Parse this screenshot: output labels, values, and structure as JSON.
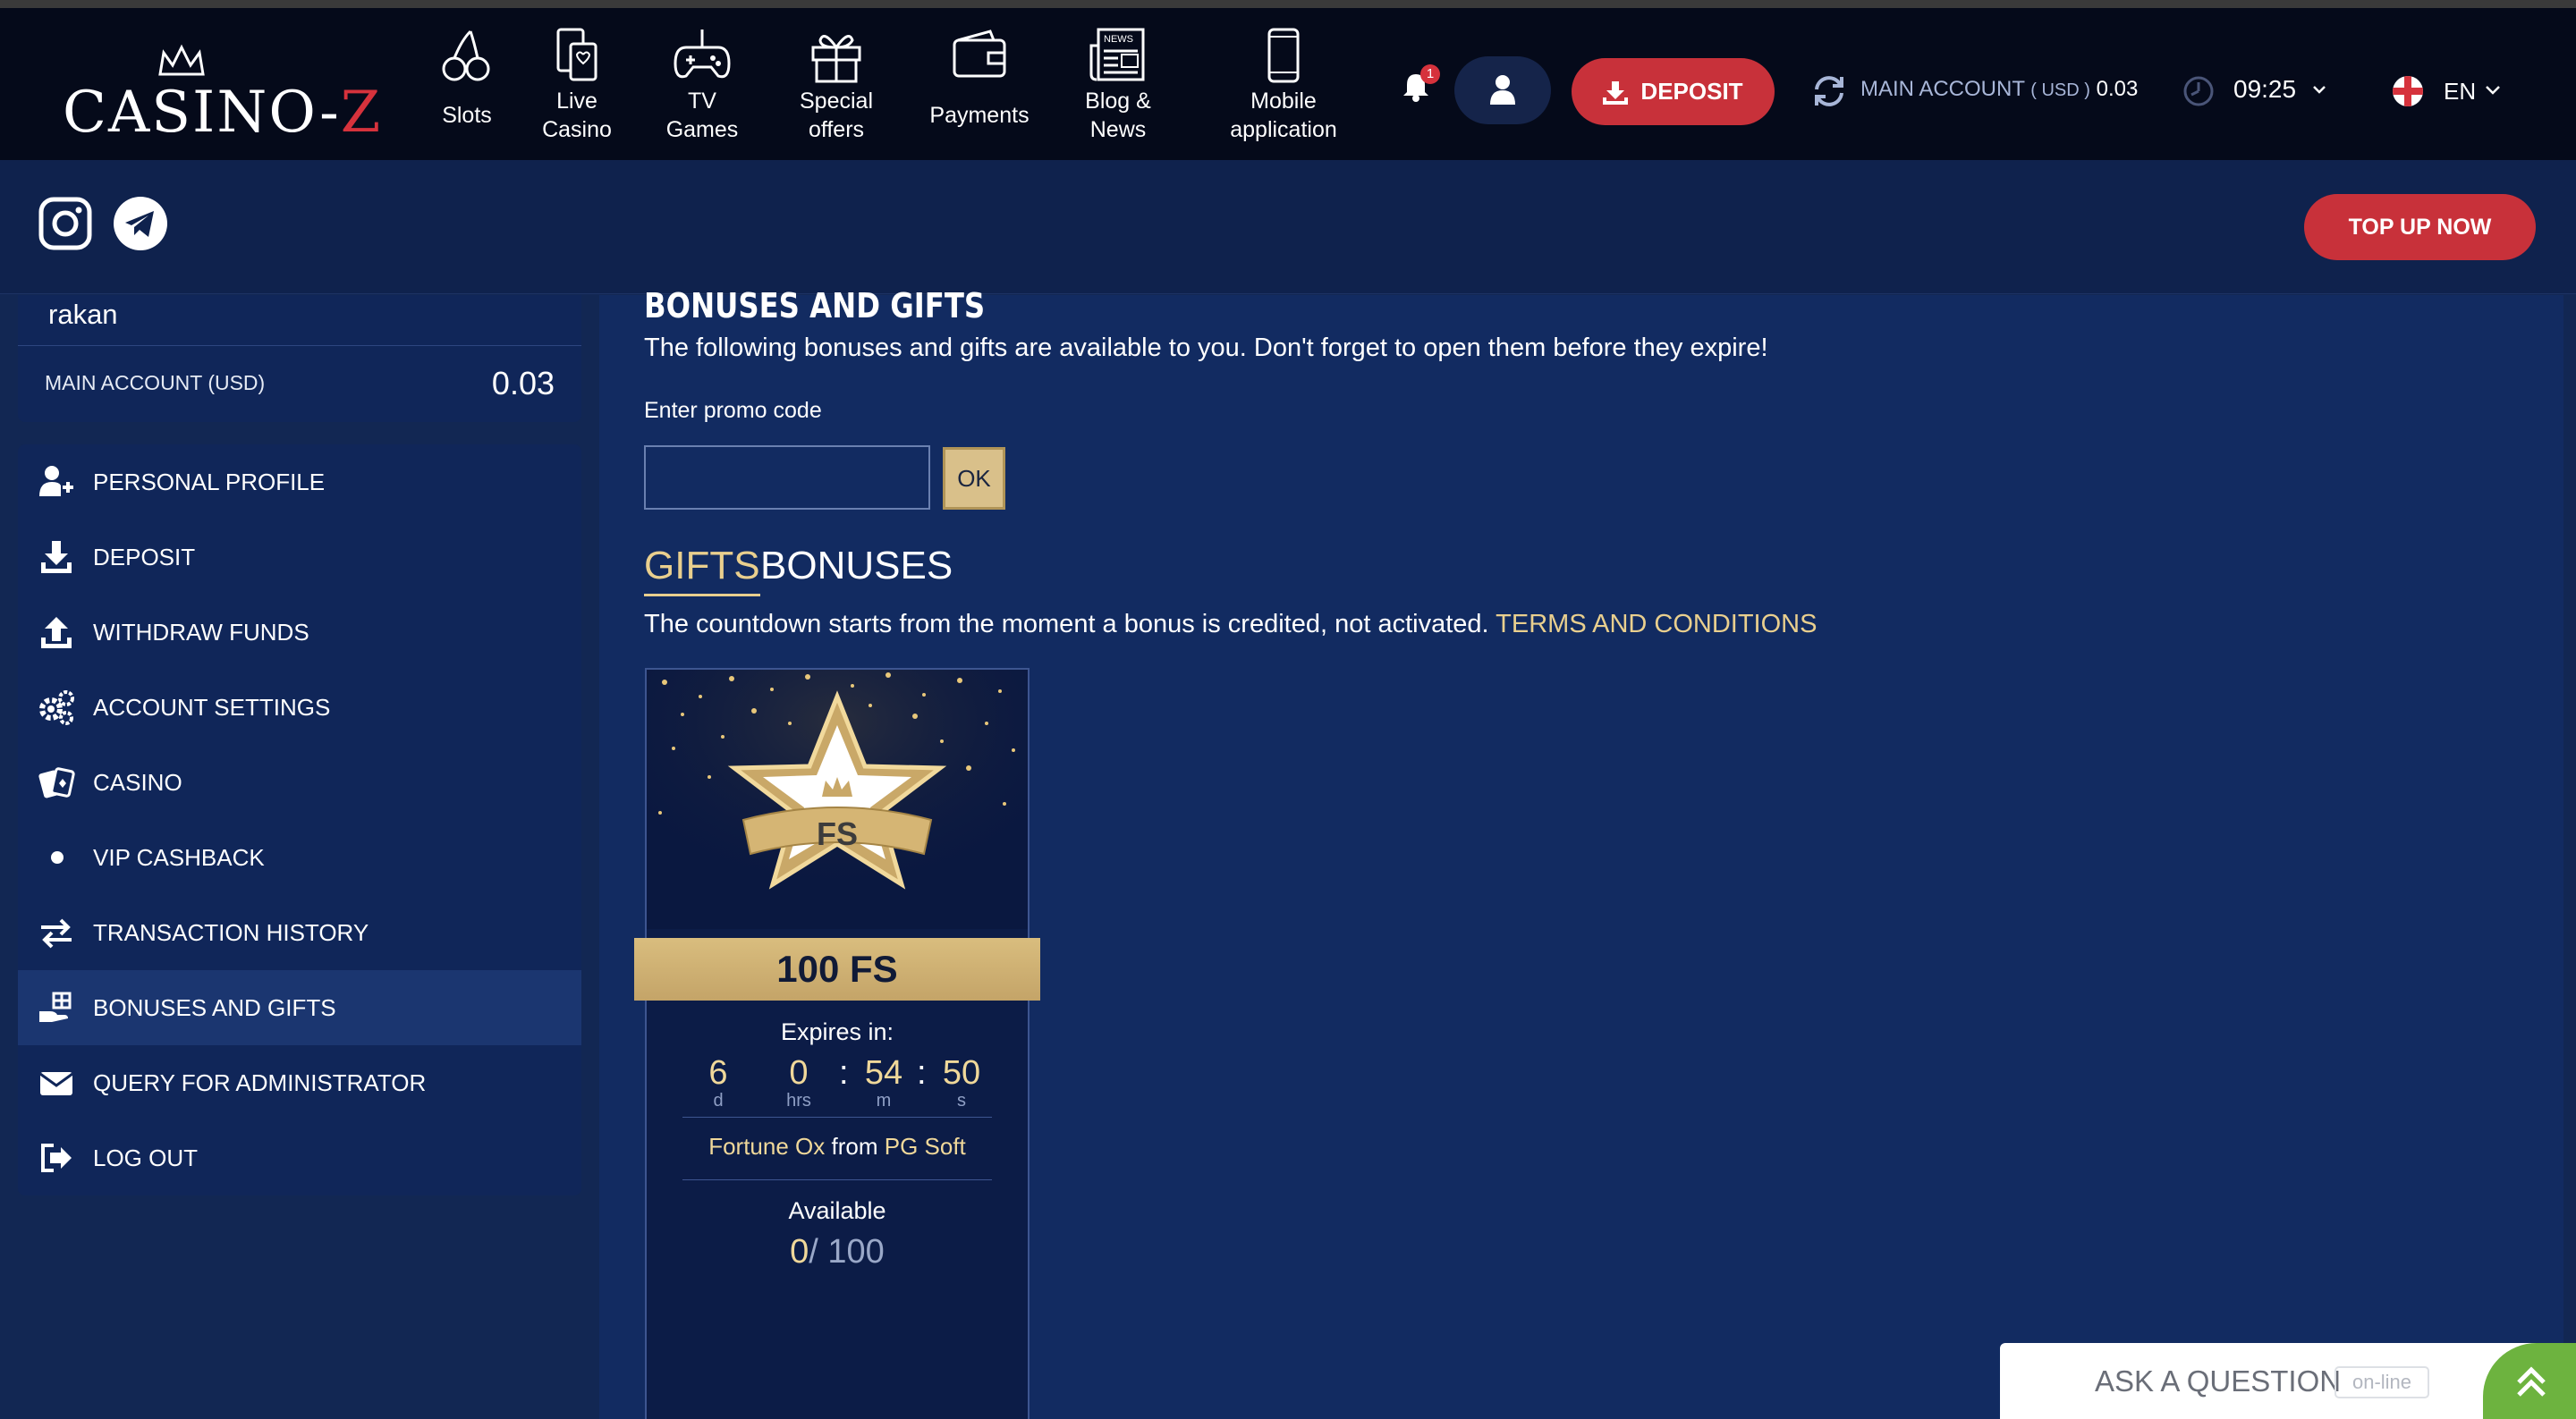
{
  "brand": {
    "logo_text_main": "CASINO-",
    "logo_text_accent": "Z"
  },
  "nav": [
    {
      "icon": "cherries-icon",
      "label_line1": "Slots",
      "label_line2": ""
    },
    {
      "icon": "phone-cards-icon",
      "label_line1": "Live",
      "label_line2": "Casino"
    },
    {
      "icon": "gamepad-icon",
      "label_line1": "TV",
      "label_line2": "Games"
    },
    {
      "icon": "gift-icon",
      "label_line1": "Special",
      "label_line2": "offers"
    },
    {
      "icon": "wallet-icon",
      "label_line1": "Payments",
      "label_line2": ""
    },
    {
      "icon": "newspaper-icon",
      "label_line1": "Blog &",
      "label_line2": "News"
    },
    {
      "icon": "smartphone-icon",
      "label_line1": "Mobile",
      "label_line2": "application"
    }
  ],
  "header": {
    "notifications_count": "1",
    "deposit_label": "DEPOSIT",
    "account_label": "MAIN ACCOUNT",
    "account_currency": "( USD )",
    "account_balance": "0.03",
    "time": "09:25",
    "language": "EN"
  },
  "social": {
    "top_up_label": "TOP UP NOW"
  },
  "sidebar": {
    "username": "rakan",
    "account_label": "MAIN ACCOUNT (USD)",
    "account_balance": "0.03",
    "items": [
      {
        "icon": "user-plus-icon",
        "label": "PERSONAL PROFILE"
      },
      {
        "icon": "download-icon",
        "label": "DEPOSIT"
      },
      {
        "icon": "upload-icon",
        "label": "WITHDRAW FUNDS"
      },
      {
        "icon": "gears-icon",
        "label": "ACCOUNT SETTINGS"
      },
      {
        "icon": "cards-icon",
        "label": "CASINO"
      },
      {
        "icon": "dot-icon",
        "label": "VIP CASHBACK"
      },
      {
        "icon": "arrows-exchange-icon",
        "label": "TRANSACTION HISTORY"
      },
      {
        "icon": "hand-gift-icon",
        "label": "BONUSES AND GIFTS",
        "active": true
      },
      {
        "icon": "envelope-icon",
        "label": "QUERY FOR ADMINISTRATOR"
      },
      {
        "icon": "logout-icon",
        "label": "LOG OUT"
      }
    ]
  },
  "main": {
    "title": "BONUSES AND GIFTS",
    "intro": "The following bonuses and gifts are available to you. Don't forget to open them before they expire!",
    "promo_label": "Enter promo code",
    "promo_value": "",
    "ok_label": "OK",
    "tabs": [
      "GIFTS",
      "BONUSES"
    ],
    "countdown_note": "The countdown starts from the moment a bonus is credited, not activated.",
    "terms_label": "TERMS AND CONDITIONS"
  },
  "gift": {
    "badge_text": "FS",
    "title": "100 FS",
    "expires_label": "Expires in:",
    "days": "6",
    "days_unit": "d",
    "hours": "0",
    "hours_unit": "hrs",
    "minutes": "54",
    "minutes_unit": "m",
    "seconds": "50",
    "seconds_unit": "s",
    "game": "Fortune Ox",
    "from_word": "from",
    "provider": "PG Soft",
    "available_label": "Available",
    "available_used": "0",
    "available_total": "/ 100"
  },
  "chat": {
    "label": "ASK A QUESTION",
    "status": "on-line"
  },
  "colors": {
    "accent_red": "#c8313a",
    "gold": "#e9cf8e",
    "bg_navy": "#122753",
    "chat_green": "#6db33f"
  }
}
